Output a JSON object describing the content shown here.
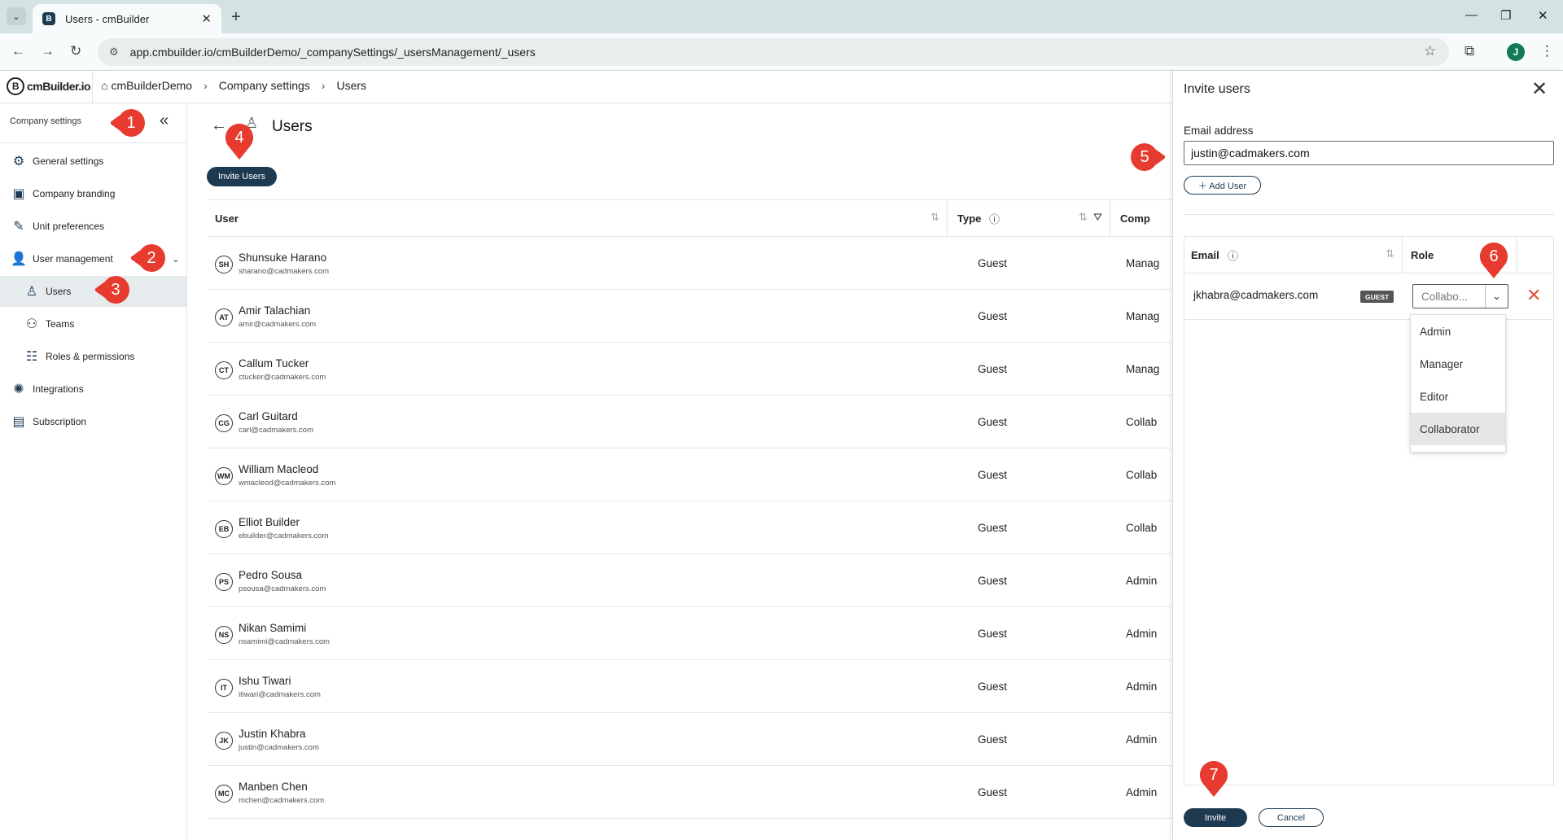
{
  "browser": {
    "tab_title": "Users - cmBuilder",
    "url": "app.cmbuilder.io/cmBuilderDemo/_companySettings/_usersManagement/_users",
    "profile_initial": "J"
  },
  "header": {
    "logo_text": "cmBuilder.io",
    "breadcrumbs": [
      "cmBuilderDemo",
      "Company settings",
      "Users"
    ]
  },
  "sidebar": {
    "title": "Company settings",
    "items": [
      {
        "label": "General settings",
        "icon": "gear-icon"
      },
      {
        "label": "Company branding",
        "icon": "branding-icon"
      },
      {
        "label": "Unit preferences",
        "icon": "ruler-icon"
      },
      {
        "label": "User management",
        "icon": "user-management-icon"
      },
      {
        "label": "Users",
        "icon": "user-icon"
      },
      {
        "label": "Teams",
        "icon": "teams-icon"
      },
      {
        "label": "Roles & permissions",
        "icon": "roles-icon"
      },
      {
        "label": "Integrations",
        "icon": "integrations-icon"
      },
      {
        "label": "Subscription",
        "icon": "subscription-icon"
      }
    ]
  },
  "main": {
    "title": "Users",
    "invite_button": "Invite Users",
    "columns": [
      "User",
      "Type",
      "Comp"
    ],
    "rows": [
      {
        "initials": "SH",
        "name": "Shunsuke Harano",
        "email": "sharano@cadmakers.com",
        "type": "Guest",
        "role": "Manag"
      },
      {
        "initials": "AT",
        "name": "Amir Talachian",
        "email": "amir@cadmakers.com",
        "type": "Guest",
        "role": "Manag"
      },
      {
        "initials": "CT",
        "name": "Callum Tucker",
        "email": "ctucker@cadmakers.com",
        "type": "Guest",
        "role": "Manag"
      },
      {
        "initials": "CG",
        "name": "Carl Guitard",
        "email": "carl@cadmakers.com",
        "type": "Guest",
        "role": "Collab"
      },
      {
        "initials": "WM",
        "name": "William Macleod",
        "email": "wmacleod@cadmakers.com",
        "type": "Guest",
        "role": "Collab"
      },
      {
        "initials": "EB",
        "name": "Elliot Builder",
        "email": "ebuilder@cadmakers.com",
        "type": "Guest",
        "role": "Collab"
      },
      {
        "initials": "PS",
        "name": "Pedro Sousa",
        "email": "psousa@cadmakers.com",
        "type": "Guest",
        "role": "Admin"
      },
      {
        "initials": "NS",
        "name": "Nikan Samimi",
        "email": "nsamimi@cadmakers.com",
        "type": "Guest",
        "role": "Admin"
      },
      {
        "initials": "IT",
        "name": "Ishu Tiwari",
        "email": "itiwari@cadmakers.com",
        "type": "Guest",
        "role": "Admin"
      },
      {
        "initials": "JK",
        "name": "Justin Khabra",
        "email": "justin@cadmakers.com",
        "type": "Guest",
        "role": "Admin"
      },
      {
        "initials": "MC",
        "name": "Manben Chen",
        "email": "mchen@cadmakers.com",
        "type": "Guest",
        "role": "Admin"
      }
    ]
  },
  "panel": {
    "title": "Invite users",
    "email_label": "Email address",
    "email_value": "justin@cadmakers.com",
    "add_user": "Add User",
    "col_email": "Email",
    "col_role": "Role",
    "invite_row": {
      "email": "jkhabra@cadmakers.com",
      "badge": "GUEST",
      "role_value": "Collabo..."
    },
    "role_options": [
      "Admin",
      "Manager",
      "Editor",
      "Collaborator"
    ],
    "invite_button": "Invite",
    "cancel_button": "Cancel"
  },
  "annotations": [
    "1",
    "2",
    "3",
    "4",
    "5",
    "6",
    "7"
  ],
  "colors": {
    "accent": "#1e3a51",
    "annotation": "#e63b2e"
  }
}
